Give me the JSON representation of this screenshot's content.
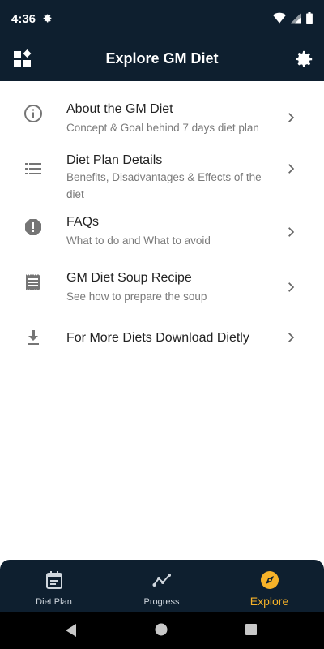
{
  "status_bar": {
    "time": "4:36"
  },
  "app_bar": {
    "title": "Explore GM Diet"
  },
  "items": [
    {
      "title": "About the GM Diet",
      "subtitle": "Concept & Goal behind 7 days diet plan",
      "icon": "info-icon"
    },
    {
      "title": "Diet Plan Details",
      "subtitle": "Benefits, Disadvantages & Effects of the diet",
      "icon": "list-icon"
    },
    {
      "title": "FAQs",
      "subtitle": "What to do and What to avoid",
      "icon": "alert-icon"
    },
    {
      "title": "GM Diet Soup Recipe",
      "subtitle": "See how to prepare the soup",
      "icon": "receipt-icon"
    },
    {
      "title": "For More Diets Download Dietly",
      "subtitle": "",
      "icon": "download-icon"
    }
  ],
  "bottom_nav": [
    {
      "label": "Diet Plan",
      "icon": "calendar-icon",
      "active": false
    },
    {
      "label": "Progress",
      "icon": "trend-icon",
      "active": false
    },
    {
      "label": "Explore",
      "icon": "compass-icon",
      "active": true
    }
  ],
  "colors": {
    "dark": "#0e1f2f",
    "accent": "#f6b229",
    "icon_grey": "#757575"
  }
}
